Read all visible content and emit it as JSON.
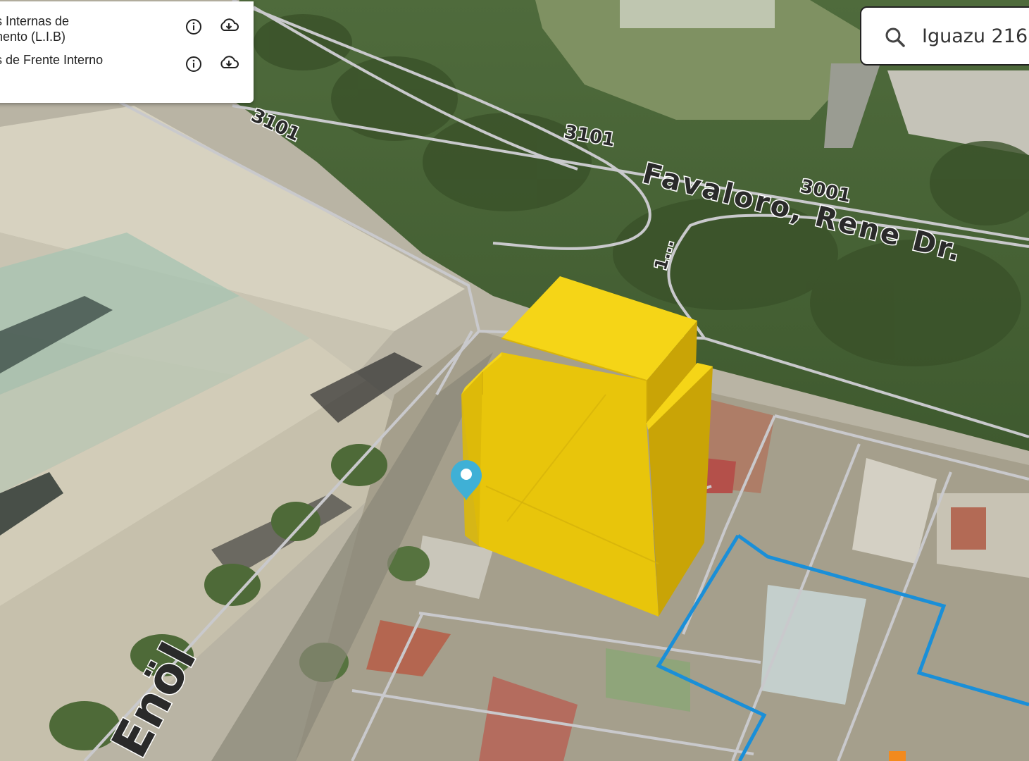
{
  "layers_panel": {
    "layers": [
      {
        "line1": "s Internas de",
        "line2": "nento (L.I.B)",
        "info_icon": "info-icon",
        "download_icon": "cloud-download-icon"
      },
      {
        "line1": "s de Frente Interno",
        "line2": "",
        "info_icon": "info-icon",
        "download_icon": "cloud-download-icon"
      }
    ]
  },
  "search": {
    "value": "Iguazu 216",
    "icon": "search-icon"
  },
  "map": {
    "street_labels": {
      "number_3101_a": "3101",
      "number_3101_b": "3101",
      "number_3001": "3001",
      "street_favaloro": "Favaloro, Rene Dr.",
      "street_partial": "1...",
      "street_lower_left": "Enöl"
    },
    "building_color": "#f2cf10",
    "parcel_outline_color": "#1a8fd8",
    "marker_color": "#3fb0d6",
    "marker_icon": "location-pin-icon"
  }
}
